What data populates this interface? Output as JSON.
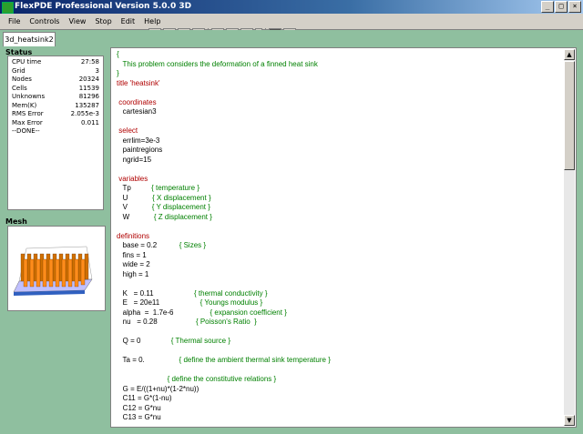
{
  "window": {
    "title": "FlexPDE Professional Version 5.0.0 3D"
  },
  "winbuttons": [
    "_",
    "□",
    "×"
  ],
  "menu": [
    "File",
    "Controls",
    "View",
    "Stop",
    "Edit",
    "Help"
  ],
  "tab": "3d_heatsink2",
  "status": {
    "header": "Status",
    "rows": [
      {
        "label": "CPU time",
        "value": "27:58"
      },
      {
        "label": "Grid",
        "value": "3"
      },
      {
        "label": "Nodes",
        "value": "20324"
      },
      {
        "label": "Cells",
        "value": "11539"
      },
      {
        "label": "Unknowns",
        "value": "81296"
      },
      {
        "label": "Mem(K)",
        "value": "135287"
      },
      {
        "label": "RMS Error",
        "value": "2.055e-3"
      },
      {
        "label": "Max Error",
        "value": "0.011"
      },
      {
        "label": "--DONE--",
        "value": ""
      }
    ]
  },
  "mesh": {
    "header": "Mesh"
  },
  "editor": {
    "lines": [
      {
        "t": "{",
        "c": "cm"
      },
      {
        "t": "   This problem considers the deformation of a finned heat sink",
        "c": "cm"
      },
      {
        "t": "}",
        "c": "cm"
      },
      {
        "t": "title 'heatsink'",
        "c": "kw"
      },
      {
        "t": "",
        "c": ""
      },
      {
        "t": " coordinates",
        "c": "kw"
      },
      {
        "t": "   cartesian3",
        "c": ""
      },
      {
        "t": "",
        "c": ""
      },
      {
        "t": " select",
        "c": "kw"
      },
      {
        "t": "   errlim=3e-3",
        "c": ""
      },
      {
        "t": "   paintregions",
        "c": ""
      },
      {
        "t": "   ngrid=15",
        "c": ""
      },
      {
        "t": "",
        "c": ""
      },
      {
        "t": " variables",
        "c": "kw"
      },
      {
        "t": "   Tp          { temperature }",
        "c": "mixvar"
      },
      {
        "t": "   U            { X displacement }",
        "c": "mixvar"
      },
      {
        "t": "   V            { Y displacement }",
        "c": "mixvar"
      },
      {
        "t": "   W            { Z displacement }",
        "c": "mixvar"
      },
      {
        "t": "",
        "c": ""
      },
      {
        "t": "definitions",
        "c": "kw"
      },
      {
        "t": "   base = 0.2           { Sizes }",
        "c": "mixdef"
      },
      {
        "t": "   fins = 1",
        "c": ""
      },
      {
        "t": "   wide = 2",
        "c": ""
      },
      {
        "t": "   high = 1",
        "c": ""
      },
      {
        "t": "",
        "c": ""
      },
      {
        "t": "   K   = 0.11                    { thermal conductivity }",
        "c": "mixdef"
      },
      {
        "t": "   E   = 20e11                    { Youngs modulus }",
        "c": "mixdef"
      },
      {
        "t": "   alpha  =  1.7e-6                  { expansion coefficient }",
        "c": "mixdef"
      },
      {
        "t": "   nu   = 0.28                   { Poisson's Ratio  }",
        "c": "mixdef"
      },
      {
        "t": "",
        "c": ""
      },
      {
        "t": "   Q = 0               { Thermal source }",
        "c": "mixdef"
      },
      {
        "t": "",
        "c": ""
      },
      {
        "t": "   Ta = 0.                 { define the ambient thermal sink temperature }",
        "c": "mixdef"
      },
      {
        "t": "",
        "c": ""
      },
      {
        "t": "                         { define the constitutive relations }",
        "c": "cm"
      },
      {
        "t": "   G = E/((1+nu)*(1-2*nu))",
        "c": ""
      },
      {
        "t": "   C11 = G*(1-nu)",
        "c": ""
      },
      {
        "t": "   C12 = G*nu",
        "c": ""
      },
      {
        "t": "   C13 = G*nu",
        "c": ""
      }
    ]
  },
  "colors": {
    "background": "#8fbf9f",
    "keyword": "#b00000",
    "comment": "#008000"
  }
}
